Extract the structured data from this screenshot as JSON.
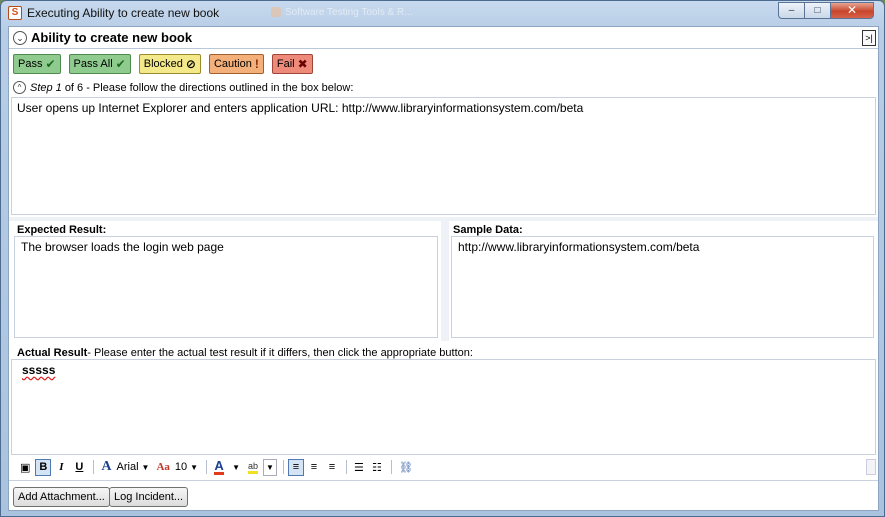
{
  "window": {
    "title": "Executing Ability to create new book",
    "background_tab": "Software Testing Tools & R...",
    "controls": {
      "minimize": "–",
      "maximize": "□",
      "close": "✕"
    }
  },
  "header": {
    "title": "Ability to create new book",
    "collapse_icon": "⌄",
    "expand_icon": ">|"
  },
  "result_buttons": [
    {
      "label": "Pass",
      "glyph": "✔"
    },
    {
      "label": "Pass All",
      "glyph": "✔"
    },
    {
      "label": "Blocked",
      "glyph": "⊘"
    },
    {
      "label": "Caution",
      "glyph": "!"
    },
    {
      "label": "Fail",
      "glyph": "✖"
    }
  ],
  "step": {
    "label": "Step 1",
    "of_text": "of 6 - Please follow the directions outlined in the box below:",
    "description": "User opens up Internet Explorer and enters application URL: http://www.libraryinformationsystem.com/beta"
  },
  "expected": {
    "label": "Expected Result:",
    "value": "The browser loads the login web page"
  },
  "sample": {
    "label": "Sample Data:",
    "value": "http://www.libraryinformationsystem.com/beta"
  },
  "actual": {
    "label": "Actual Result",
    "hint": "- Please enter the actual test result if it differs, then click the appropriate button:",
    "value": "sssss"
  },
  "toolbar": {
    "font_name": "Arial",
    "font_size": "10",
    "bold": "B",
    "italic": "I",
    "underline": "U",
    "font_icon": "A",
    "size_icon": "Aa",
    "color_icon": "A",
    "highlight_icon": "ab"
  },
  "footer": {
    "add_attachment": "Add Attachment...",
    "log_incident": "Log Incident..."
  },
  "colors": {
    "pass": "#8fcb8f",
    "blocked": "#f4e98a",
    "caution": "#f3b07a",
    "fail": "#ee8a7a"
  }
}
